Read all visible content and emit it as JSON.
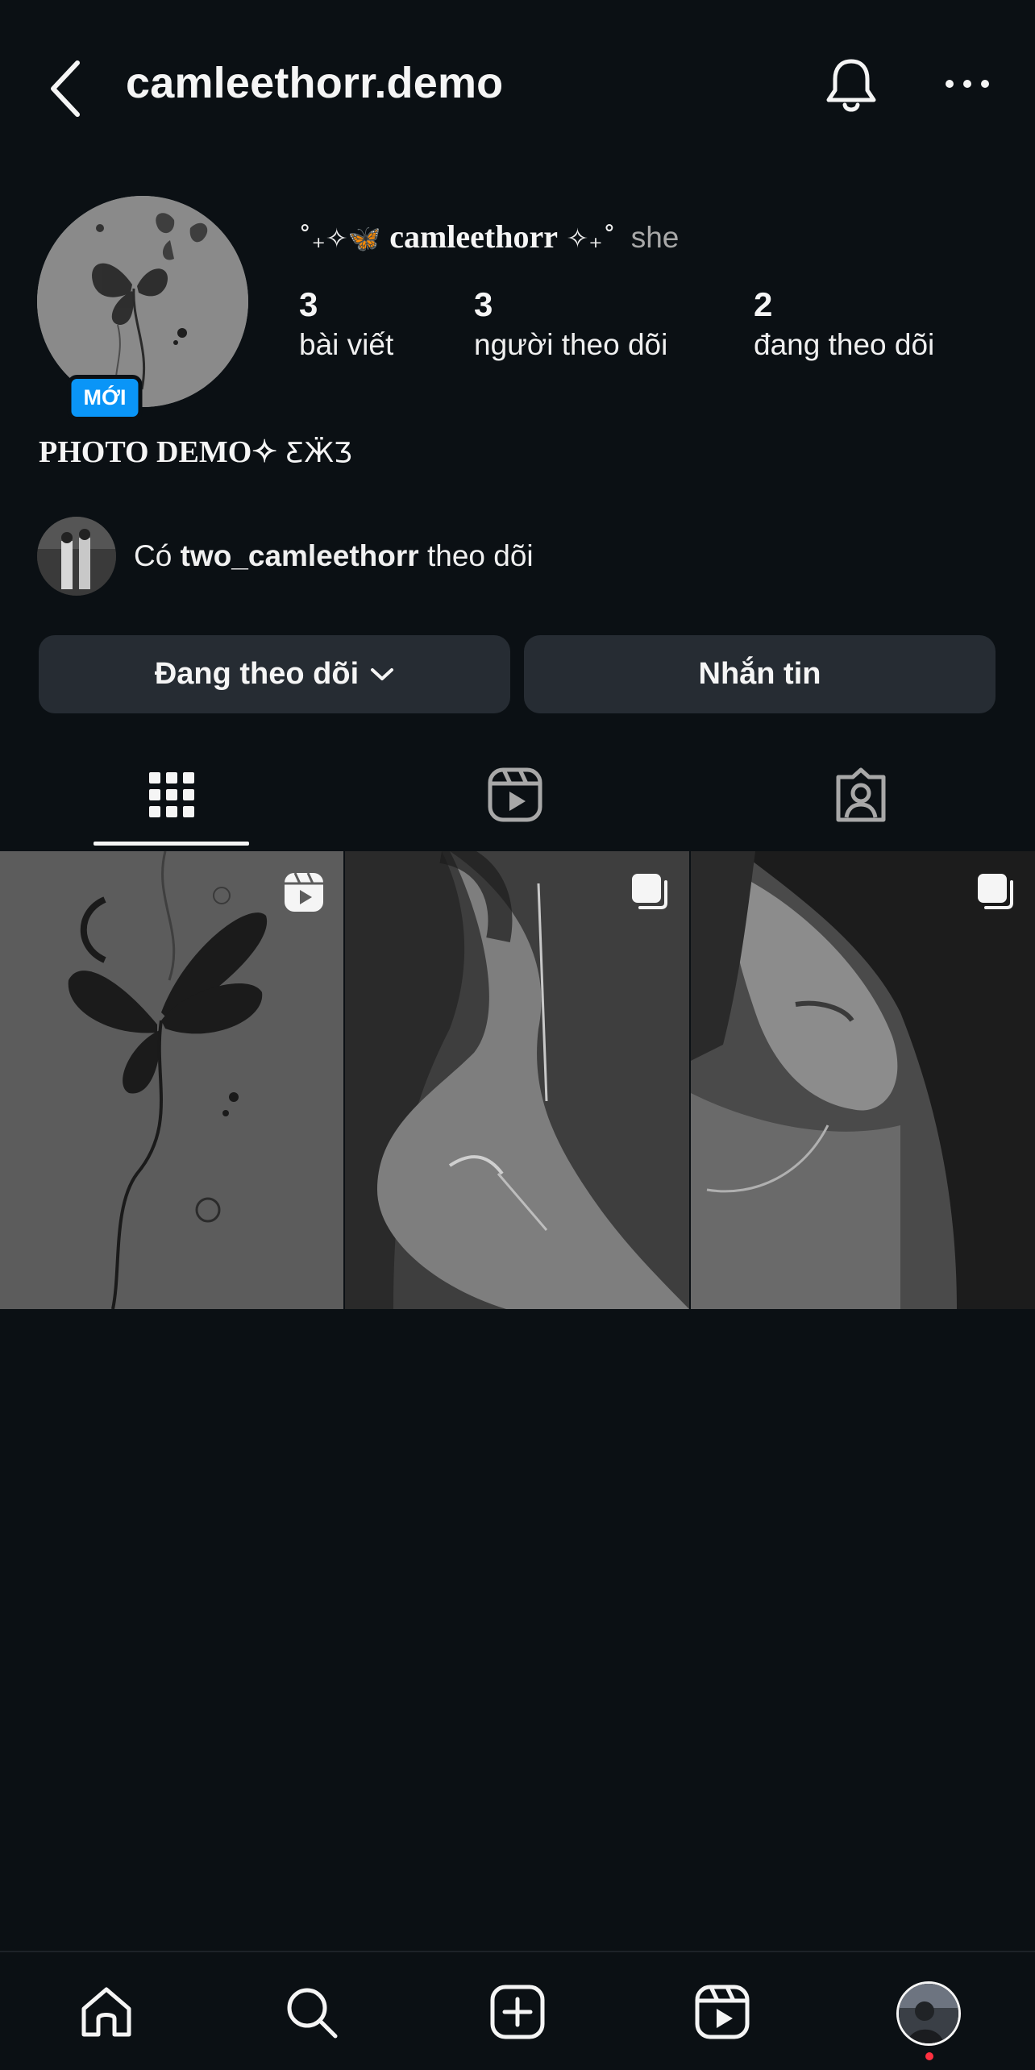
{
  "header": {
    "username": "camleethorr.demo",
    "back_icon": "chevron-left-icon",
    "bell_icon": "bell-icon",
    "more_icon": "more-horizontal-icon"
  },
  "profile": {
    "new_badge": "MỚI",
    "name_prefix": "˚₊✧🦋",
    "name": "camleethorr",
    "name_suffix": "✧₊˚",
    "pronoun": "she",
    "stats": [
      {
        "value": "3",
        "label": "bài viết"
      },
      {
        "value": "3",
        "label": "người theo dõi"
      },
      {
        "value": "2",
        "label": "đang theo dõi"
      }
    ],
    "bio_main": "PHOTO DEMO✧",
    "bio_deco": "ƸӜƷ",
    "mutual_prefix": "Có",
    "mutual_user": "two_camleethorr",
    "mutual_suffix": "theo dõi"
  },
  "actions": {
    "following_label": "Đang theo dõi",
    "message_label": "Nhắn tin"
  },
  "tabs": [
    {
      "icon": "grid-icon",
      "active": true
    },
    {
      "icon": "reels-icon",
      "active": false
    },
    {
      "icon": "tagged-icon",
      "active": false
    }
  ],
  "posts": [
    {
      "type": "reel",
      "badge_icon": "reels-badge-icon"
    },
    {
      "type": "carousel",
      "badge_icon": "carousel-badge-icon"
    },
    {
      "type": "carousel",
      "badge_icon": "carousel-badge-icon"
    }
  ],
  "bottom_nav": [
    "home-icon",
    "search-icon",
    "create-icon",
    "reels-icon",
    "profile-avatar"
  ],
  "colors": {
    "background": "#0b1014",
    "button": "#262c33",
    "badge": "#0a95f7",
    "notification_dot": "#ff3040"
  }
}
